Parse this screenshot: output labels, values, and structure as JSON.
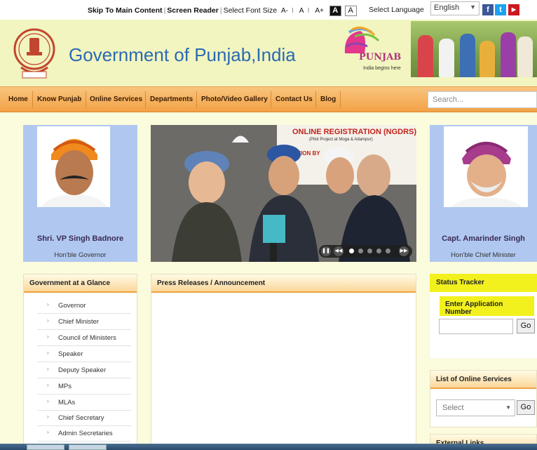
{
  "topbar": {
    "skip_link": "Skip To Main Content",
    "screen_reader": "Screen Reader",
    "select_font_size": "Select Font Size",
    "font_minus": "A-",
    "font_normal": "A",
    "font_plus": "A+",
    "contrast_dark": "A",
    "contrast_light": "A",
    "select_language": "Select Language",
    "language_value": "English"
  },
  "header": {
    "title": "Government of Punjab,India",
    "logo_word": "PUNJAB",
    "logo_tagline": "India begins here"
  },
  "nav": {
    "items": [
      "Home",
      "Know Punjab",
      "Online Services",
      "Departments",
      "Photo/Video Gallery",
      "Contact Us",
      "Blog"
    ],
    "search_placeholder": "Search..."
  },
  "governor": {
    "name": "Shri. VP Singh Badnore",
    "role": "Hon'ble Governor"
  },
  "chief_minister": {
    "name": "Capt. Amarinder Singh",
    "role": "Hon'ble Chief Minister"
  },
  "slider": {
    "banner_title": "ONLINE REGISTRATION (NGDRS)",
    "banner_sub": "(Pilot Project at Moga & Adampur)",
    "banner_line": "MARCATION BY"
  },
  "glance": {
    "heading": "Government at a Glance",
    "items": [
      "Governor",
      "Chief Minister",
      "Council of Ministers",
      "Speaker",
      "Deputy Speaker",
      "MPs",
      "MLAs",
      "Chief Secretary",
      "Admin Secretaries"
    ]
  },
  "press": {
    "heading": "Press Releases / Announcement"
  },
  "status_tracker": {
    "heading": "Status Tracker",
    "label": "Enter Application Number",
    "go": "Go"
  },
  "online_services": {
    "heading": "List of Online Services",
    "select_placeholder": "Select",
    "go": "Go"
  },
  "external_links": {
    "heading": "External Links"
  }
}
